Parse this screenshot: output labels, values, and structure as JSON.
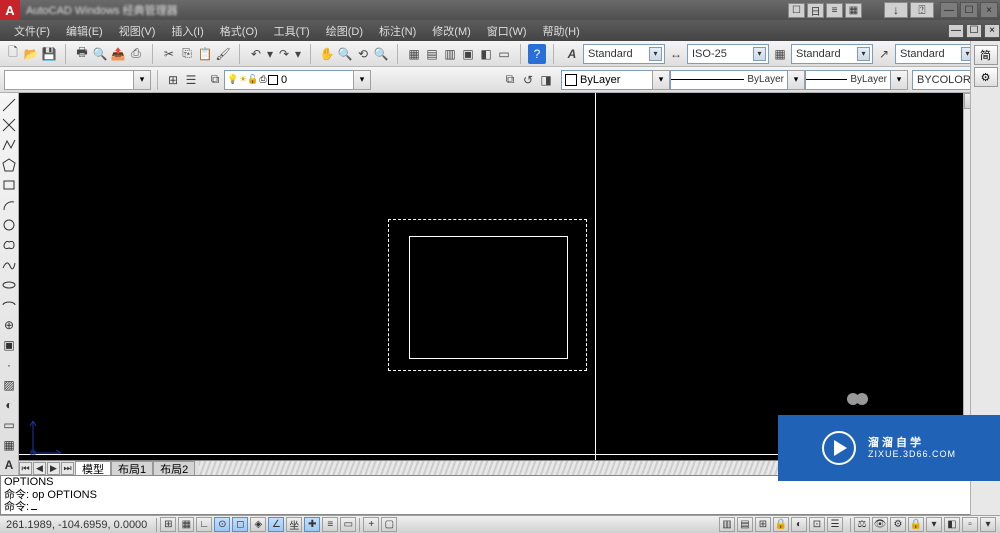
{
  "titlebar": {
    "logo": "A",
    "title": "AutoCAD   Windows 经典管理器",
    "btn_min": "—",
    "btn_max": "☐",
    "btn_close": "×",
    "btn_help": "?",
    "btn_down": "▾",
    "btn_ext": "⍰"
  },
  "menubar": {
    "items": [
      "文件(F)",
      "编辑(E)",
      "视图(V)",
      "插入(I)",
      "格式(O)",
      "工具(T)",
      "绘图(D)",
      "标注(N)",
      "修改(M)",
      "窗口(W)",
      "帮助(H)"
    ],
    "win_min": "—",
    "win_max": "☐",
    "win_close": "×"
  },
  "dropdowns": {
    "style1": "Standard",
    "style2": "ISO-25",
    "style3": "Standard",
    "style4": "Standard"
  },
  "toolbar2": {
    "layer": "0",
    "bylayer1": "ByLayer",
    "bylayer2": "ByLayer",
    "bylayer3": "ByLayer",
    "color": "BYCOLOR"
  },
  "tabs": {
    "model": "模型",
    "layout1": "布局1",
    "layout2": "布局2",
    "cmd_label": "命令:",
    "coord_x": "261.1989",
    "coord_y": "-104.6959"
  },
  "cmdpanel": {
    "l1": "OPTIONS",
    "l2": "命令: op OPTIONS",
    "l3": "命令:"
  },
  "status": {
    "coords": "261.1989, -104.6959, 0.0000"
  },
  "overlay": {
    "brand": "溜溜自学",
    "url": "ZIXUE.3D66.COM"
  },
  "side": {
    "jian": "简"
  }
}
